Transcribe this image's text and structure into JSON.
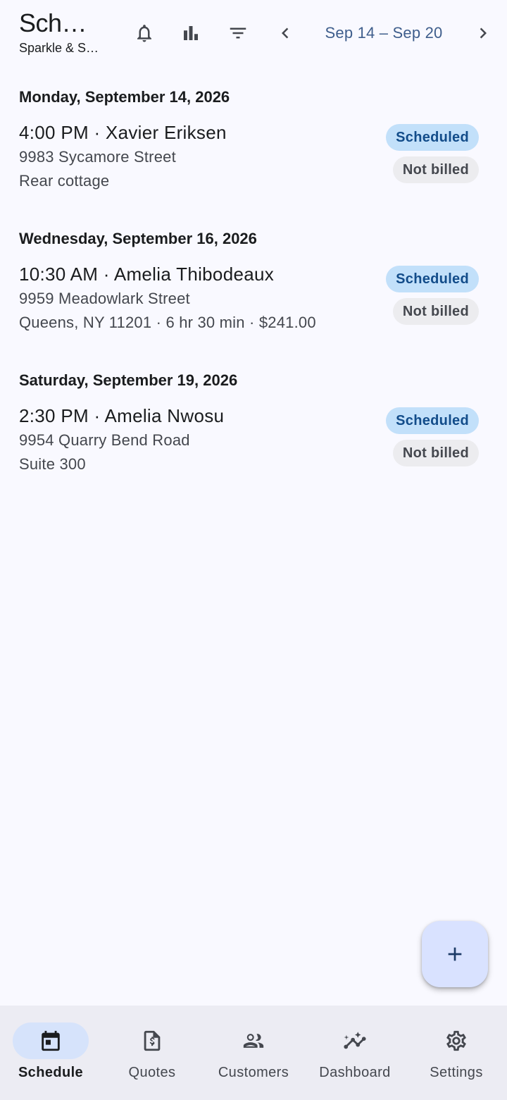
{
  "header": {
    "title": "Sche…",
    "subtitle": "Sparkle & S…",
    "date_range": "Sep 14 – Sep 20",
    "icons": [
      "bell-icon",
      "bar-chart-icon",
      "filter-icon",
      "chevron-left-icon",
      "chevron-right-icon"
    ]
  },
  "days": [
    {
      "heading": "Monday, September 14, 2026",
      "jobs": [
        {
          "title": "4:00 PM · Xavier Eriksen",
          "line1": "9983 Sycamore Street",
          "line2": "Rear cottage",
          "status": "Scheduled",
          "billing": "Not billed"
        }
      ]
    },
    {
      "heading": "Wednesday, September 16, 2026",
      "jobs": [
        {
          "title": "10:30 AM · Amelia Thibodeaux",
          "line1": "9959 Meadowlark Street",
          "line2": "Queens, NY 11201 · 6 hr 30 min · $241.00",
          "status": "Scheduled",
          "billing": "Not billed"
        }
      ]
    },
    {
      "heading": "Saturday, September 19, 2026",
      "jobs": [
        {
          "title": "2:30 PM · Amelia Nwosu",
          "line1": "9954 Quarry Bend Road",
          "line2": "Suite 300",
          "status": "Scheduled",
          "billing": "Not billed"
        }
      ]
    }
  ],
  "fab": {
    "icon": "plus-icon"
  },
  "bottom_nav": {
    "items": [
      {
        "label": "Schedule",
        "icon": "calendar-icon",
        "active": true
      },
      {
        "label": "Quotes",
        "icon": "invoice-icon",
        "active": false
      },
      {
        "label": "Customers",
        "icon": "people-icon",
        "active": false
      },
      {
        "label": "Dashboard",
        "icon": "insights-icon",
        "active": false
      },
      {
        "label": "Settings",
        "icon": "gear-icon",
        "active": false
      }
    ]
  },
  "colors": {
    "background": "#f9f9ff",
    "accent": "#3f5e8c",
    "status_badge": "#c2e0fa",
    "billing_badge": "#ececef",
    "fab": "#d9e2ff",
    "nav_active_pill": "#d6e3fb"
  }
}
